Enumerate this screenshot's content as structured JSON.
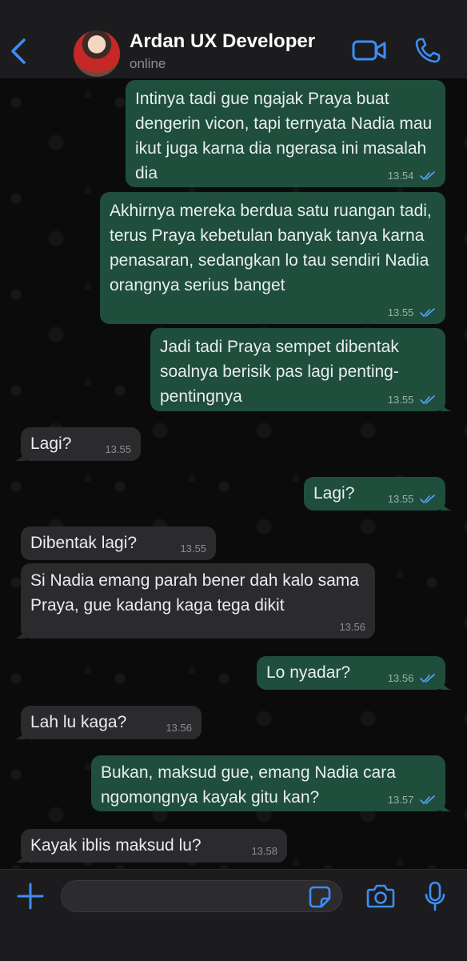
{
  "header": {
    "contact_name": "Ardan UX Developer",
    "status": "online",
    "icons": [
      "back-chevron-icon",
      "avatar",
      "video-call-icon",
      "phone-call-icon"
    ]
  },
  "colors": {
    "accent": "#3d8ef5",
    "outgoing_bubble": "#1f4e3d",
    "incoming_bubble": "#2b2b2d",
    "background": "#0b0b0c"
  },
  "messages": [
    {
      "dir": "out",
      "text": "Intinya tadi gue ngajak Praya buat dengerin vicon, tapi ternyata Nadia mau ikut juga karna dia ngerasa ini masalah dia",
      "time": "13.54",
      "read": true
    },
    {
      "dir": "out",
      "text": "Akhirnya mereka berdua satu ruangan tadi, terus Praya kebetulan banyak tanya karna penasaran, sedangkan lo tau sendiri Nadia orangnya serius banget",
      "time": "13.55",
      "read": true
    },
    {
      "dir": "out",
      "text": "Jadi tadi Praya sempet dibentak soalnya berisik pas lagi penting-pentingnya",
      "time": "13.55",
      "read": true
    },
    {
      "dir": "in",
      "text": "Lagi?",
      "time": "13.55"
    },
    {
      "dir": "out",
      "text": "Lagi?",
      "time": "13.55",
      "read": true
    },
    {
      "dir": "in",
      "text": "Dibentak lagi?",
      "time": "13.55"
    },
    {
      "dir": "in",
      "text": "Si Nadia emang parah bener dah kalo sama Praya, gue kadang kaga tega dikit",
      "time": "13.56"
    },
    {
      "dir": "out",
      "text": "Lo nyadar?",
      "time": "13.56",
      "read": true
    },
    {
      "dir": "in",
      "text": "Lah lu kaga?",
      "time": "13.56"
    },
    {
      "dir": "out",
      "text": "Bukan, maksud gue, emang Nadia cara ngomongnya kayak gitu kan?",
      "time": "13.57",
      "read": true
    },
    {
      "dir": "in",
      "text": "Kayak iblis maksud lu?",
      "time": "13.58"
    }
  ],
  "composer": {
    "placeholder": "",
    "icons": [
      "plus-icon",
      "sticker-icon",
      "camera-icon",
      "microphone-icon"
    ]
  }
}
